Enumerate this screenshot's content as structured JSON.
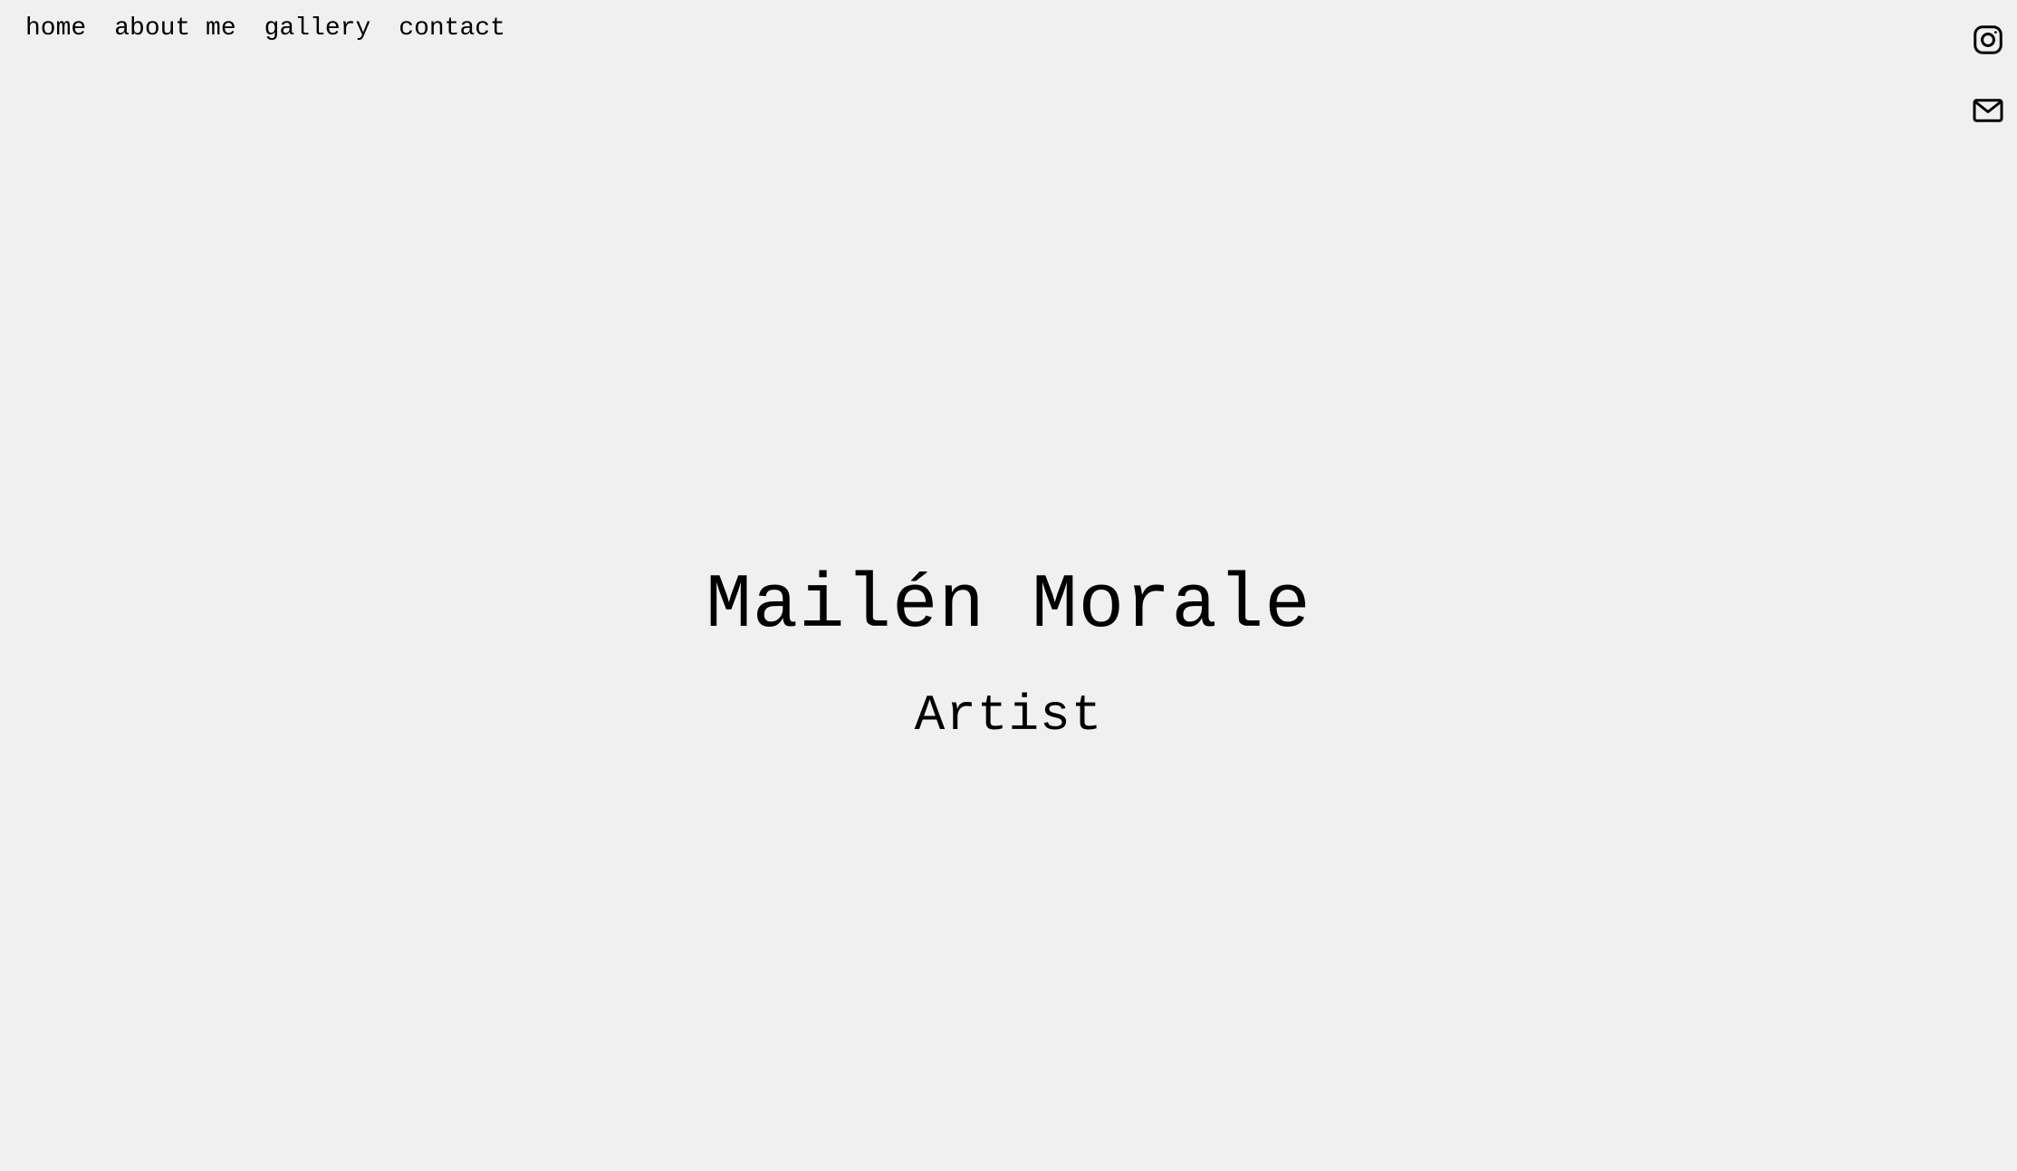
{
  "nav": {
    "items": [
      {
        "label": "home"
      },
      {
        "label": "about me"
      },
      {
        "label": "gallery"
      },
      {
        "label": "contact"
      }
    ]
  },
  "social": {
    "icons": [
      "instagram-icon",
      "mail-icon"
    ]
  },
  "hero": {
    "name": "Mailén Morale",
    "role": "Artist"
  },
  "colors": {
    "background": "#f0f0f0",
    "text": "#000000"
  }
}
